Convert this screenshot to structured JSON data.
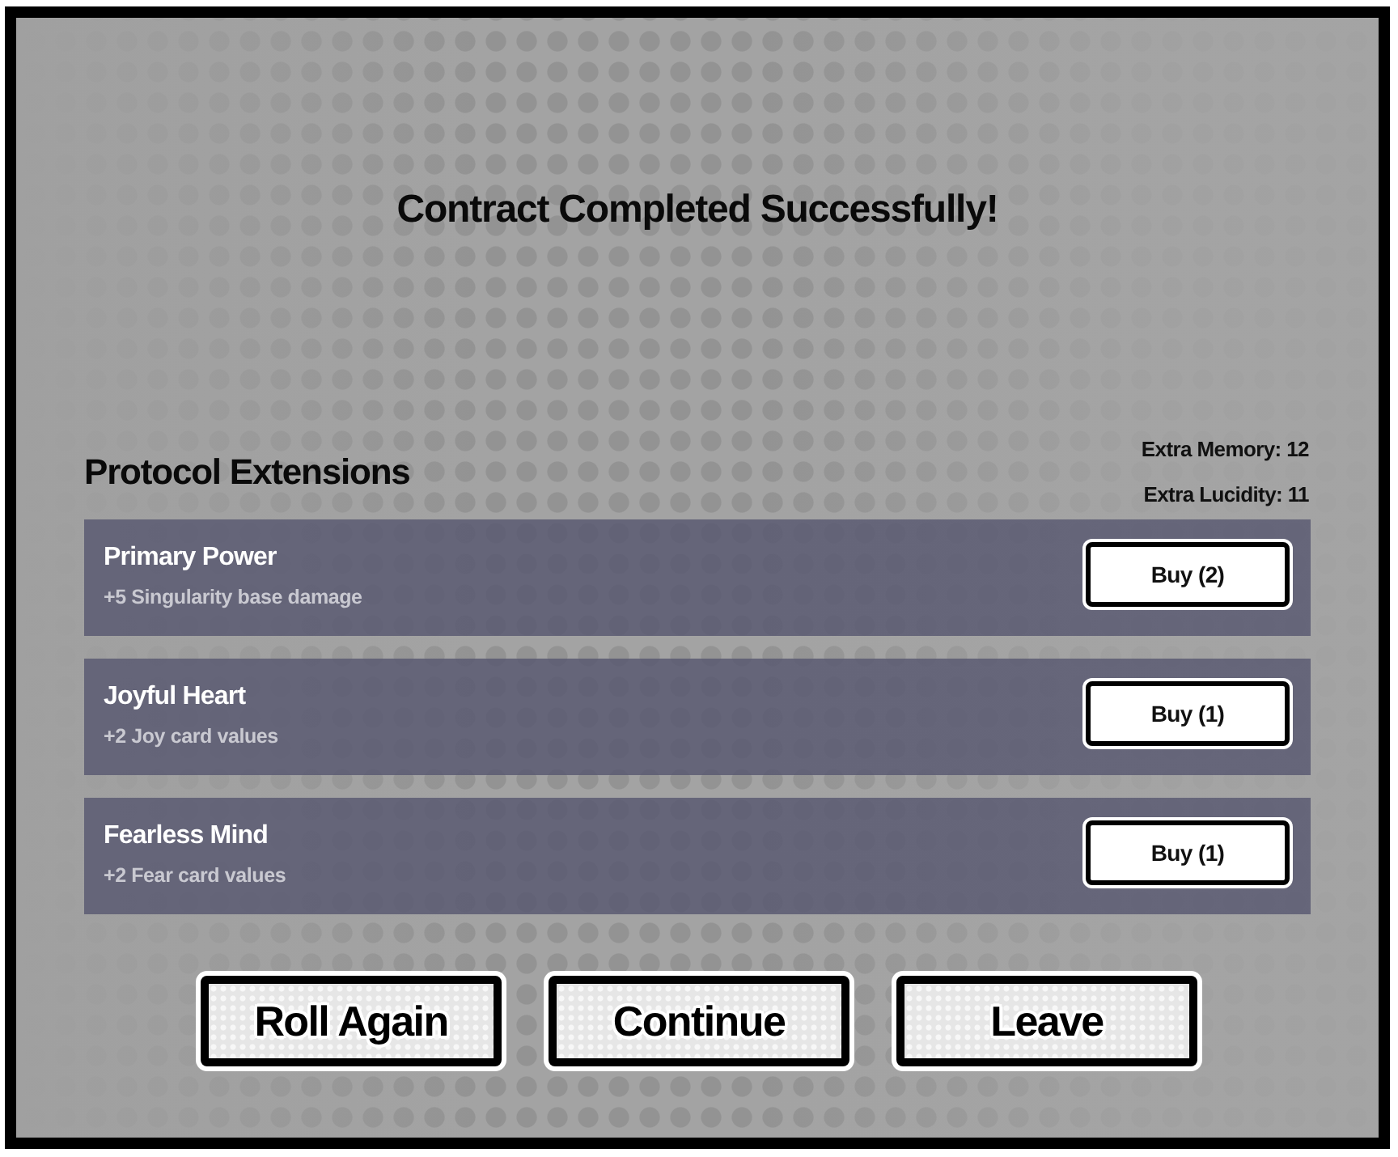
{
  "dialog": {
    "title": "Contract Completed Successfully!"
  },
  "section": {
    "heading": "Protocol Extensions",
    "stats": [
      "Extra Memory: 12",
      "Extra Lucidity: 11"
    ]
  },
  "extensions": [
    {
      "name": "Primary Power",
      "effect": "+5 Singularity base damage",
      "buy_label": "Buy (2)"
    },
    {
      "name": "Joyful Heart",
      "effect": "+2 Joy card values",
      "buy_label": "Buy (1)"
    },
    {
      "name": "Fearless Mind",
      "effect": "+2 Fear card values",
      "buy_label": "Buy (1)"
    }
  ],
  "actions": [
    "Roll Again",
    "Continue",
    "Leave"
  ]
}
